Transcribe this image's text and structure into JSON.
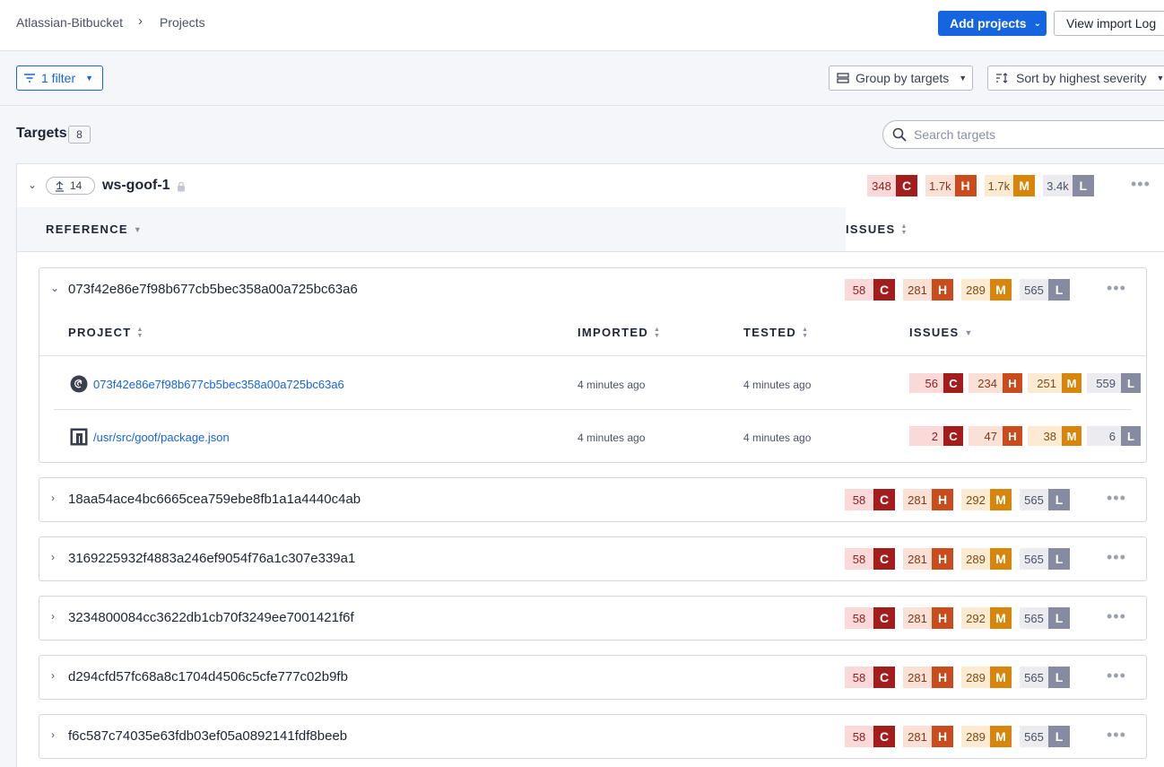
{
  "breadcrumb": {
    "org": "Atlassian-Bitbucket",
    "separator": "›",
    "page": "Projects"
  },
  "header": {
    "add_projects": "Add projects",
    "view_import_log": "View import Log"
  },
  "toolbar": {
    "filter_label": "1 filter",
    "group_label": "Group by targets",
    "sort_label": "Sort by highest severity"
  },
  "targets": {
    "title": "Targets",
    "count": "8",
    "search_placeholder": "Search targets"
  },
  "target": {
    "name": "ws-goof-1",
    "ref_count": "14",
    "issues": {
      "c": "348",
      "h": "1.7k",
      "m": "1.7k",
      "l": "3.4k"
    }
  },
  "severity_labels": {
    "c": "C",
    "h": "H",
    "m": "M",
    "l": "L"
  },
  "columns": {
    "reference": "REFERENCE",
    "issues": "ISSUES",
    "project": "PROJECT",
    "imported": "IMPORTED",
    "tested": "TESTED"
  },
  "references": [
    {
      "name": "073f42e86e7f98b677cb5bec358a00a725bc63a6",
      "expanded": true,
      "issues": {
        "c": "58",
        "h": "281",
        "m": "289",
        "l": "565"
      },
      "projects": [
        {
          "name": "073f42e86e7f98b677cb5bec358a00a725bc63a6",
          "icon": "debian-icon",
          "imported": "4 minutes ago",
          "tested": "4 minutes ago",
          "issues": {
            "c": "56",
            "h": "234",
            "m": "251",
            "l": "559"
          }
        },
        {
          "name": "/usr/src/goof/package.json",
          "icon": "npm-icon",
          "imported": "4 minutes ago",
          "tested": "4 minutes ago",
          "issues": {
            "c": "2",
            "h": "47",
            "m": "38",
            "l": "6"
          }
        }
      ]
    },
    {
      "name": "18aa54ace4bc6665cea759ebe8fb1a1a4440c4ab",
      "issues": {
        "c": "58",
        "h": "281",
        "m": "292",
        "l": "565"
      }
    },
    {
      "name": "3169225932f4883a246ef9054f76a1c307e339a1",
      "issues": {
        "c": "58",
        "h": "281",
        "m": "289",
        "l": "565"
      }
    },
    {
      "name": "3234800084cc3622db1cb70f3249ee7001421f6f",
      "issues": {
        "c": "58",
        "h": "281",
        "m": "292",
        "l": "565"
      }
    },
    {
      "name": "d294cfd57fc68a8c1704d4506c5cfe777c02b9fb",
      "issues": {
        "c": "58",
        "h": "281",
        "m": "289",
        "l": "565"
      }
    },
    {
      "name": "f6c587c74035e63fdb03ef05a0892141fdf8beeb",
      "issues": {
        "c": "58",
        "h": "281",
        "m": "289",
        "l": "565"
      }
    }
  ],
  "colors": {
    "accent": "#1565e0",
    "critical": "#a41d1d",
    "high": "#ca4b1b",
    "medium": "#d8850c",
    "low": "#878ba1"
  }
}
